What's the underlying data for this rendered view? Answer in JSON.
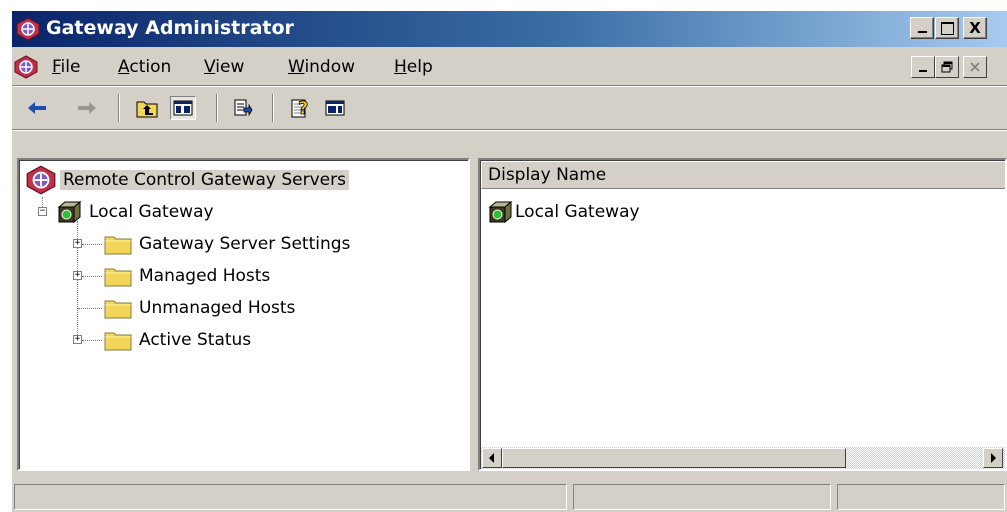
{
  "window": {
    "title": "Gateway Administrator",
    "caption_buttons": [
      "_",
      "□",
      "X"
    ]
  },
  "menubar": {
    "items": [
      {
        "label": "File",
        "mnemonic": "F",
        "rest": "ile"
      },
      {
        "label": "Action",
        "mnemonic": "A",
        "rest": "ction"
      },
      {
        "label": "View",
        "mnemonic": "V",
        "rest": "iew"
      },
      {
        "label": "Window",
        "mnemonic": "W",
        "rest": "indow"
      },
      {
        "label": "Help",
        "mnemonic": "H",
        "rest": "elp"
      }
    ]
  },
  "toolbar": {
    "buttons": [
      "back-icon",
      "forward-icon",
      "up-one-level-icon",
      "show-hide-console-tree-icon",
      "export-list-icon",
      "help-icon",
      "show-hide-action-pane-icon"
    ]
  },
  "tree": {
    "root": "Remote Control Gateway Servers",
    "gateway": "Local Gateway",
    "children": [
      "Gateway Server Settings",
      "Managed Hosts",
      "Unmanaged Hosts",
      "Active Status"
    ]
  },
  "details": {
    "column_header": "Display Name",
    "items": [
      "Local Gateway"
    ]
  },
  "colors": {
    "title_gradient_start": "#0a246a",
    "title_gradient_end": "#a6caf0",
    "chrome": "#d4d0c8",
    "folder": "#f4d55c",
    "gateway_green": "#2ec02e"
  }
}
